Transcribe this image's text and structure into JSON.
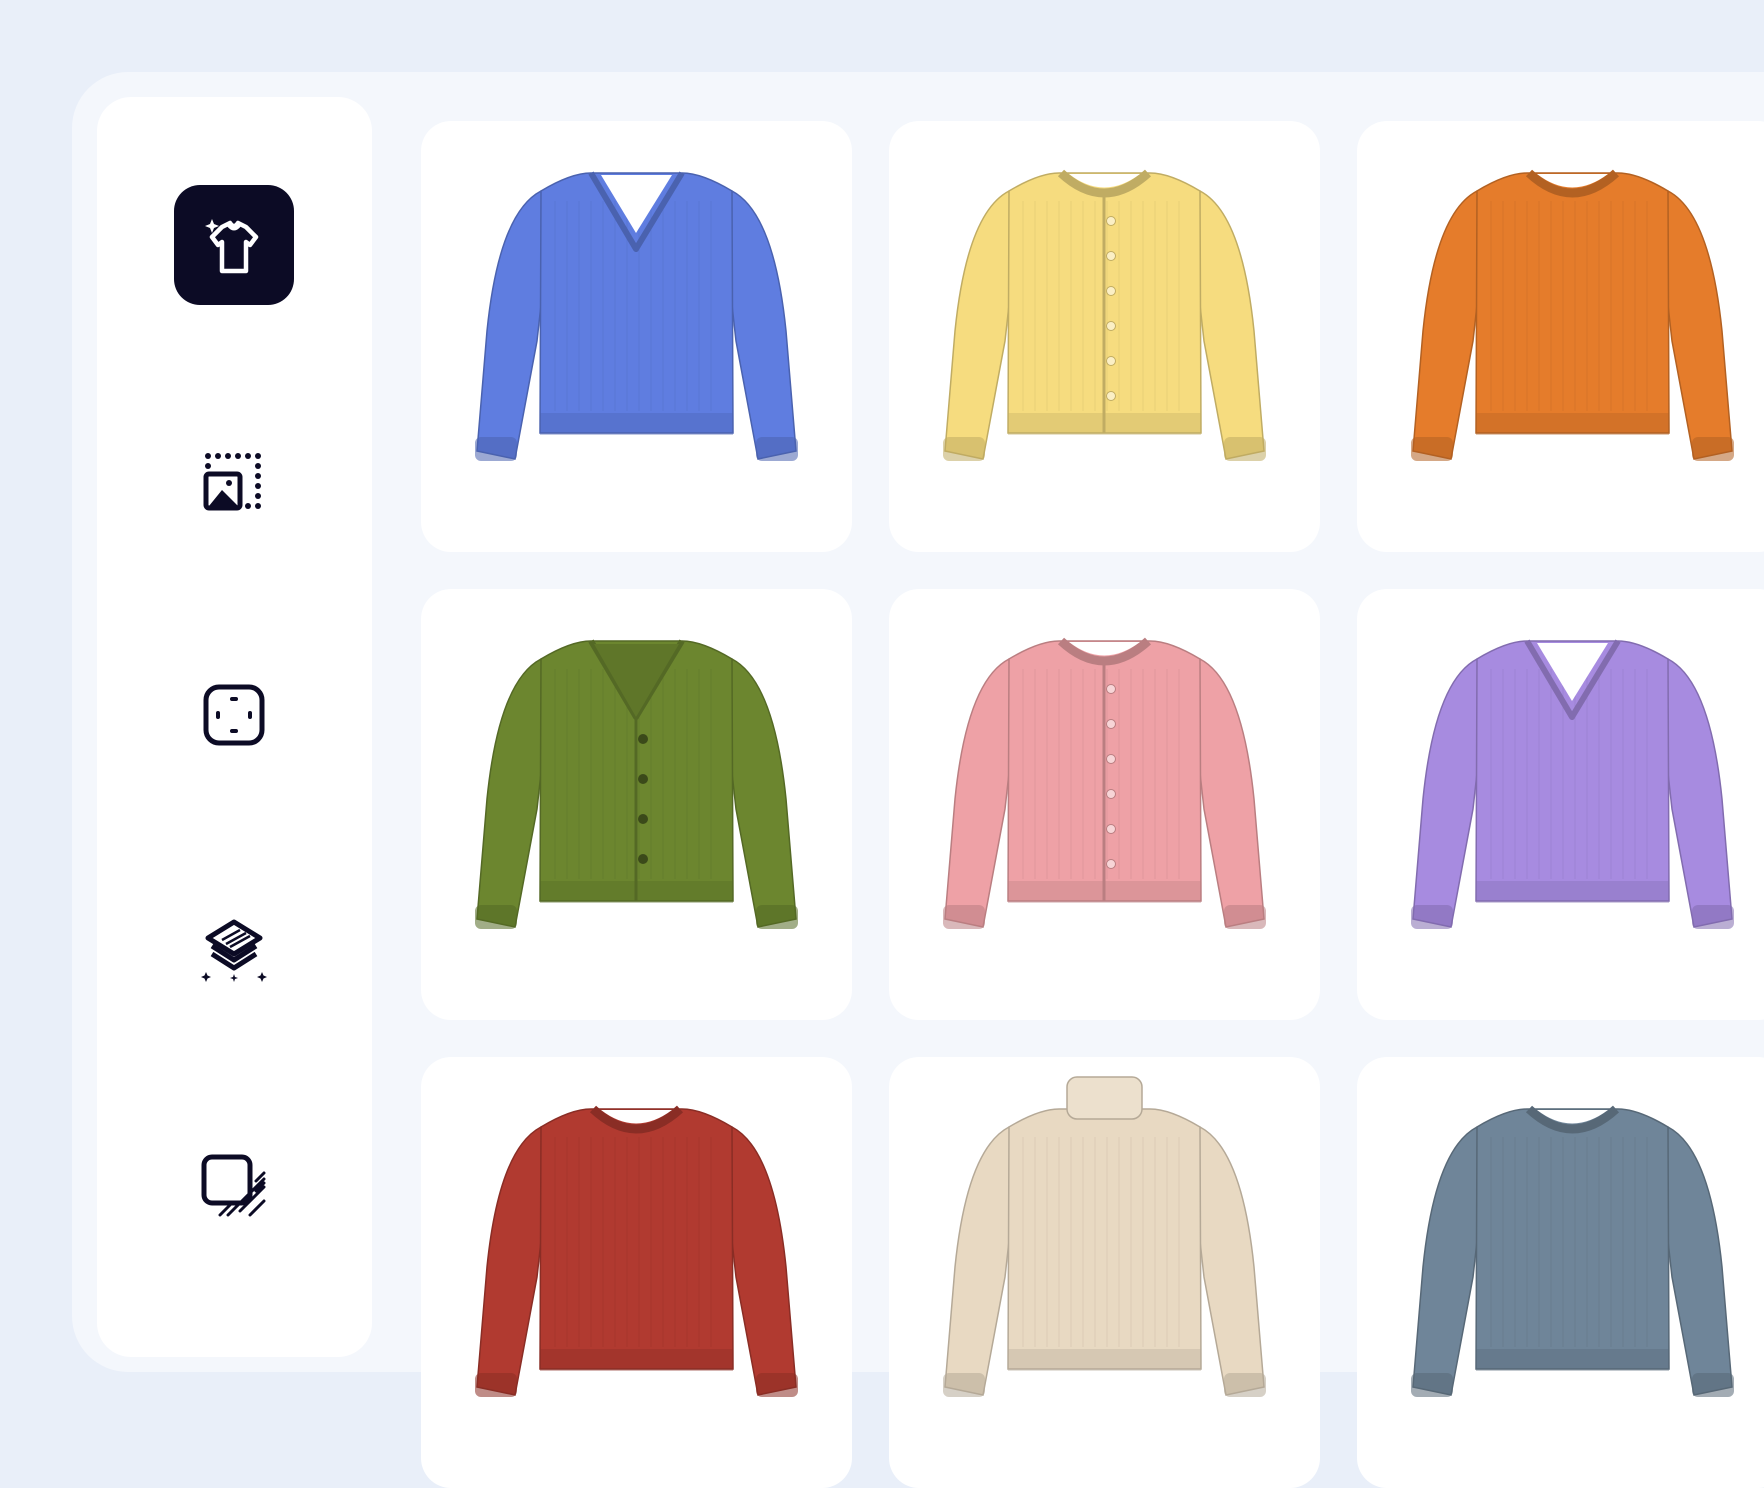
{
  "sidebar": {
    "brand": {
      "icon": "tshirt-sparkle-icon",
      "bg_color": "#0c0b25"
    },
    "tools": [
      {
        "icon": "image-crop-frame-icon"
      },
      {
        "icon": "focus-frame-icon"
      },
      {
        "icon": "layers-sparkle-icon"
      },
      {
        "icon": "square-shadow-icon"
      }
    ]
  },
  "products": [
    {
      "kind": "v-neck-sweater",
      "color": "#5f7de0"
    },
    {
      "kind": "crew-cardigan",
      "color": "#f6dc7f"
    },
    {
      "kind": "crew-sweater",
      "color": "#e57c2b"
    },
    {
      "kind": "v-neck-cardigan",
      "color": "#6c862f"
    },
    {
      "kind": "crew-cardigan",
      "color": "#eea1a6"
    },
    {
      "kind": "v-neck-sweater",
      "color": "#a78be0"
    },
    {
      "kind": "crew-sweater",
      "color": "#b13a30"
    },
    {
      "kind": "turtleneck-sweater",
      "color": "#e8d9c2"
    },
    {
      "kind": "crew-sweater",
      "color": "#6f8599"
    }
  ]
}
